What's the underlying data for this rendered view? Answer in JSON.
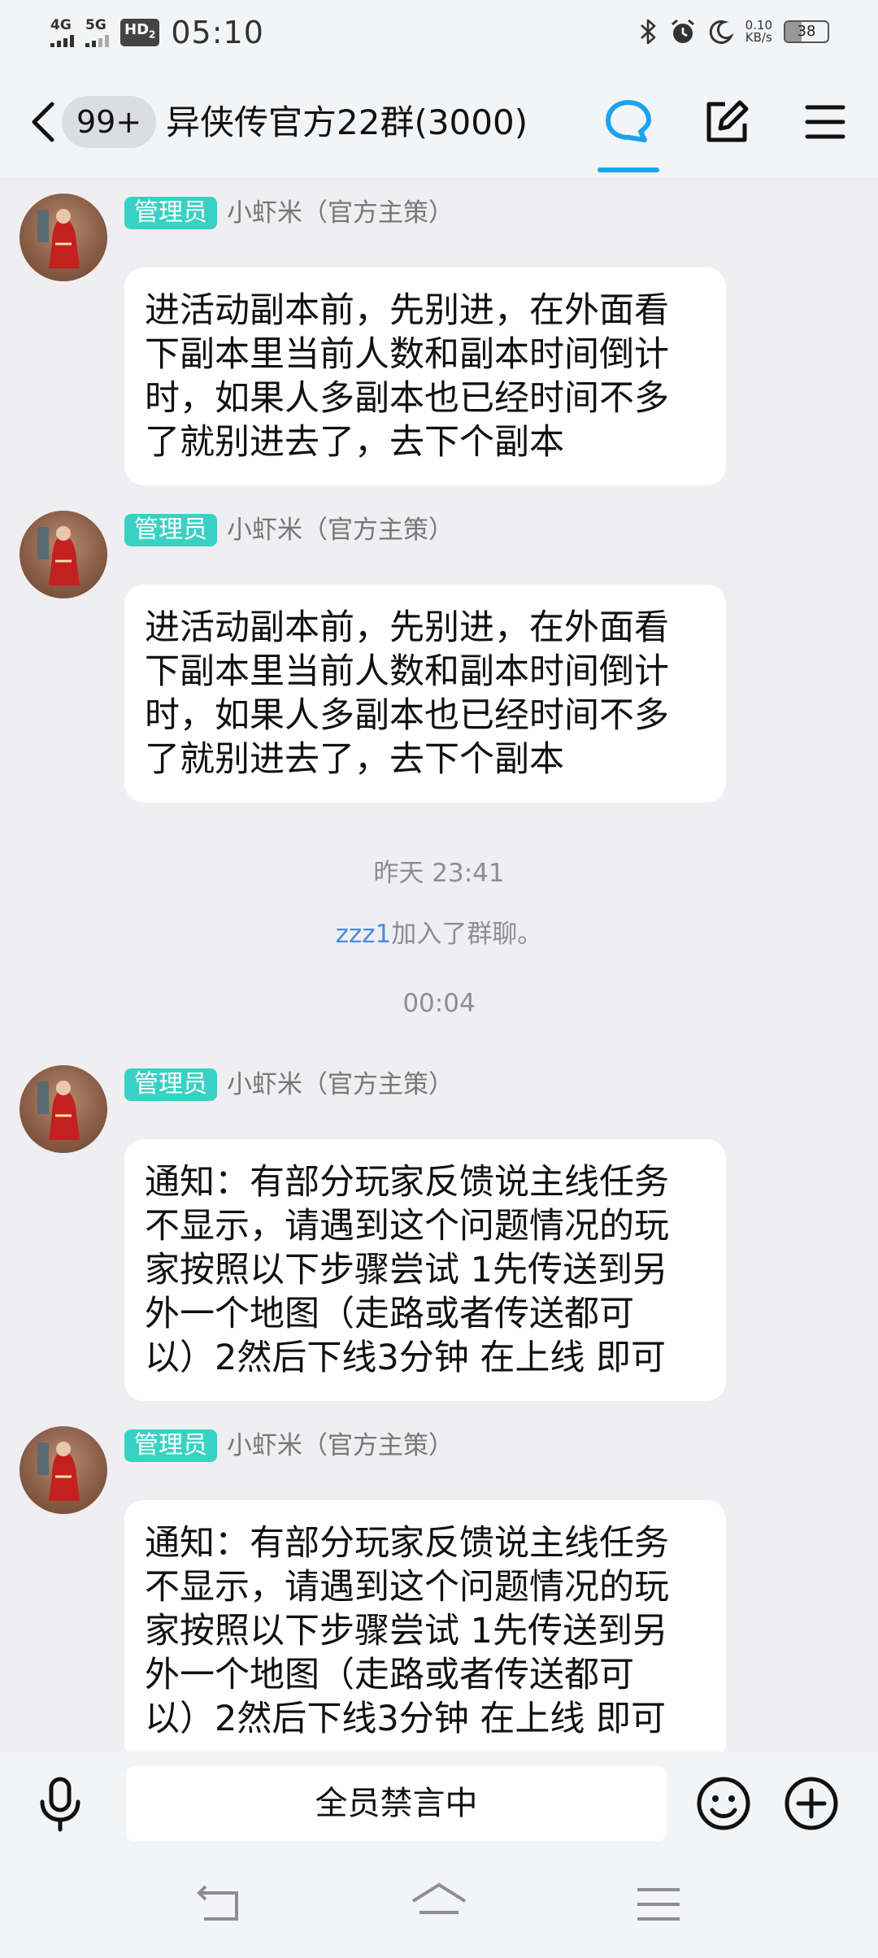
{
  "status_bar": {
    "signal1_label": "4G",
    "signal2_label": "5G",
    "hd_label": "HD",
    "hd_sub": "2",
    "time": "05:10",
    "net_speed_value": "0.10",
    "net_speed_unit": "KB/s",
    "battery": "38"
  },
  "header": {
    "unread_count": "99+",
    "title": "异侠传官方22群(3000)"
  },
  "messages": [
    {
      "role": "管理员",
      "sender": "小虾米（官方主策）",
      "text": "进活动副本前，先别进，在外面看\n下副本里当前人数和副本时间倒计\n时，如果人多副本也已经时间不多\n了就别进去了，去下个副本"
    },
    {
      "role": "管理员",
      "sender": "小虾米（官方主策）",
      "text": "进活动副本前，先别进，在外面看\n下副本里当前人数和副本时间倒计\n时，如果人多副本也已经时间不多\n了就别进去了，去下个副本"
    },
    {
      "role": "管理员",
      "sender": "小虾米（官方主策）",
      "text": "通知：有部分玩家反馈说主线任务\n不显示，请遇到这个问题情况的玩\n家按照以下步骤尝试 1先传送到另\n外一个地图（走路或者传送都可\n以）2然后下线3分钟 在上线 即可"
    },
    {
      "role": "管理员",
      "sender": "小虾米（官方主策）",
      "text": "通知：有部分玩家反馈说主线任务\n不显示，请遇到这个问题情况的玩\n家按照以下步骤尝试 1先传送到另\n外一个地图（走路或者传送都可\n以）2然后下线3分钟 在上线 即可"
    }
  ],
  "system": {
    "timestamp1": "昨天 23:41",
    "join_user": "zzz1",
    "join_text": "加入了群聊。",
    "timestamp2": "00:04"
  },
  "input_bar": {
    "muted_text": "全员禁言中"
  },
  "colors": {
    "accent": "#1ea2ee",
    "admin_badge": "#39d1c3",
    "background": "#efeff2",
    "link": "#4a8fd9"
  }
}
